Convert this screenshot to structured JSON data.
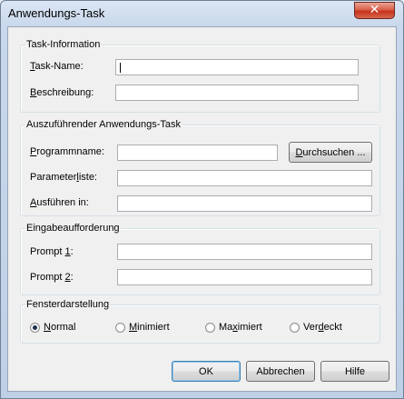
{
  "window": {
    "title": "Anwendungs-Task",
    "close_glyph": "✕"
  },
  "task_info": {
    "legend": "Task-Information",
    "name_label": {
      "key": "T",
      "rest": "ask-Name:"
    },
    "name_value": "",
    "desc_label": {
      "key": "B",
      "rest": "eschreibung:"
    },
    "desc_value": ""
  },
  "app_task": {
    "legend": "Auszuführender Anwendungs-Task",
    "program_label": {
      "key": "P",
      "rest": "rogrammname:"
    },
    "program_value": "",
    "browse_button": {
      "key": "D",
      "rest": "urchsuchen ..."
    },
    "params_label": {
      "pre": "Parameter",
      "key": "l",
      "rest": "iste:"
    },
    "params_value": "",
    "run_in_label": {
      "key": "A",
      "rest": "usführen in:"
    },
    "run_in_value": ""
  },
  "prompt": {
    "legend": "Eingabeaufforderung",
    "prompt1_label": {
      "pre": "Prompt ",
      "key": "1",
      "rest": ":"
    },
    "prompt1_value": "",
    "prompt2_label": {
      "pre": "Prompt ",
      "key": "2",
      "rest": ":"
    },
    "prompt2_value": ""
  },
  "window_display": {
    "legend": "Fensterdarstellung",
    "options": [
      {
        "key": "N",
        "rest": "ormal",
        "checked": true
      },
      {
        "key": "M",
        "rest": "inimiert",
        "checked": false
      },
      {
        "pre": "Ma",
        "key": "x",
        "rest": "imiert",
        "checked": false
      },
      {
        "pre": "Ver",
        "key": "d",
        "rest": "eckt",
        "checked": false
      }
    ]
  },
  "buttons": {
    "ok": "OK",
    "cancel": "Abbrechen",
    "help": "Hilfe"
  }
}
